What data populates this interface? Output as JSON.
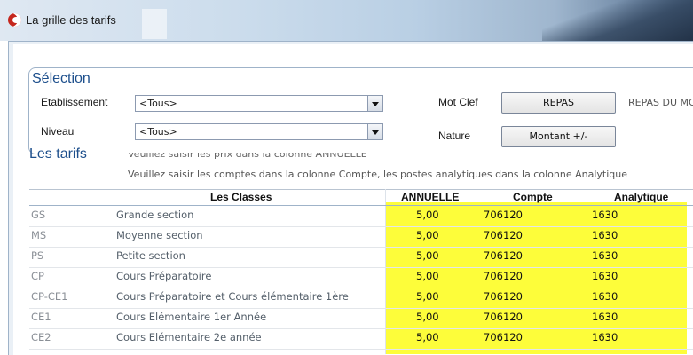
{
  "window": {
    "title": "La grille des tarifs"
  },
  "selection": {
    "title": "Sélection",
    "etablissement_label": "Etablissement",
    "etablissement_value": "<Tous>",
    "niveau_label": "Niveau",
    "niveau_value": "<Tous>",
    "mot_clef_label": "Mot Clef",
    "mot_clef_button": "REPAS",
    "mot_clef_desc": "REPAS DU MO",
    "nature_label": "Nature",
    "nature_button": "Montant +/-"
  },
  "tarifs": {
    "title": "Les tarifs",
    "hint1": "Veuillez saisir les prix dans la colonne ANNUELLE",
    "hint2": "Veuillez saisir les comptes dans la colonne Compte, les postes analytiques dans la colonne Analytique",
    "headers": {
      "classes": "Les Classes",
      "annuelle": "ANNUELLE",
      "compte": "Compte",
      "analytique": "Analytique"
    },
    "rows": [
      {
        "code": "GS",
        "classe": "Grande section",
        "annuelle": "5,00",
        "compte": "706120",
        "analytique": "1630"
      },
      {
        "code": "MS",
        "classe": "Moyenne section",
        "annuelle": "5,00",
        "compte": "706120",
        "analytique": "1630"
      },
      {
        "code": "PS",
        "classe": "Petite section",
        "annuelle": "5,00",
        "compte": "706120",
        "analytique": "1630"
      },
      {
        "code": "CP",
        "classe": "Cours Préparatoire",
        "annuelle": "5,00",
        "compte": "706120",
        "analytique": "1630"
      },
      {
        "code": "CP-CE1",
        "classe": "Cours Préparatoire et Cours élémentaire 1ère",
        "annuelle": "5,00",
        "compte": "706120",
        "analytique": "1630"
      },
      {
        "code": "CE1",
        "classe": "Cours Elémentaire 1er Année",
        "annuelle": "5,00",
        "compte": "706120",
        "analytique": "1630"
      },
      {
        "code": "CE2",
        "classe": "Cours Elémentaire 2e année",
        "annuelle": "5,00",
        "compte": "706120",
        "analytique": "1630"
      }
    ]
  },
  "colors": {
    "highlight": "#fdfd3a",
    "section_title": "#1d4f8c"
  }
}
